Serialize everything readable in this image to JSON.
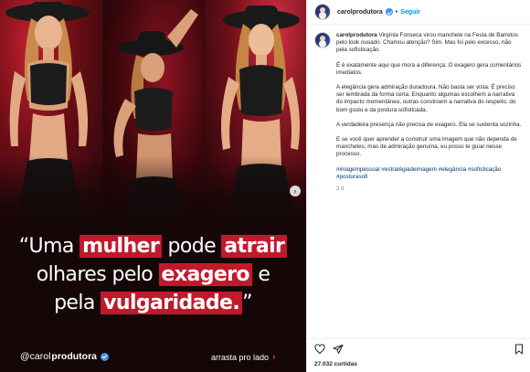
{
  "post": {
    "username": "carolprodutora",
    "follow_label": "Seguir",
    "separator": "•"
  },
  "media": {
    "quote_lines": [
      [
        {
          "text": "“Uma ",
          "hl": false
        },
        {
          "text": "mulher",
          "hl": true
        },
        {
          "text": " pode ",
          "hl": false
        },
        {
          "text": "atrair",
          "hl": true
        }
      ],
      [
        {
          "text": "olhares",
          "hl": false
        },
        {
          "text": " pelo ",
          "hl": false
        },
        {
          "text": "exagero",
          "hl": true
        },
        {
          "text": " e",
          "hl": false
        }
      ],
      [
        {
          "text": "pela ",
          "hl": false
        },
        {
          "text": "vulgaridade.",
          "hl": true
        },
        {
          "text": "”",
          "hl": false
        }
      ]
    ],
    "handle_prefix": "@carol",
    "handle_bold": "produtora",
    "swipe_label": "arrasta pro lado",
    "highlight_color": "#c0192c"
  },
  "caption": {
    "username": "carolprodutora",
    "intro": "Virgínia Fonseca virou manchete na Festa de Barretos pelo look ousado. Chamou atenção? Sim. Mas foi pelo excesso, não pela sofisticação.",
    "paragraphs": [
      "É é exatamente aqui que mora a diferença: O exagero gera comentários imediatos.",
      "A elegância gera admiração duradoura. Não basta ser vista. É preciso ser lembrada da forma certa. Enquanto algumas escolhem a narrativa do impacto momentâneo, outras constroem a narrativa do respeito, do bom gosto e da postura sofisticada.",
      "A verdadeira presença não precisa de exagero. Ela se sustenta sozinha.",
      "E se você quer aprender a construir uma imagem que não dependa de manchetes, mas de admiração genuína, eu posso te guiar nesse processo."
    ],
    "hashtags": "#imagempessoal #estratégiadeimagem #elegância #sofisticação #posturasofi",
    "time": "3 d"
  },
  "stats": {
    "likes": "27.032 curtidas"
  },
  "icons": {
    "verified": "verified-badge-icon",
    "next": "chevron-right-icon",
    "like": "heart-icon",
    "share": "send-icon",
    "save": "bookmark-icon",
    "swipe_arrow": "chevron-right-icon"
  },
  "colors": {
    "accent_blue": "#0095f6",
    "hashtag": "#00376b",
    "brand_red": "#c0192c"
  }
}
